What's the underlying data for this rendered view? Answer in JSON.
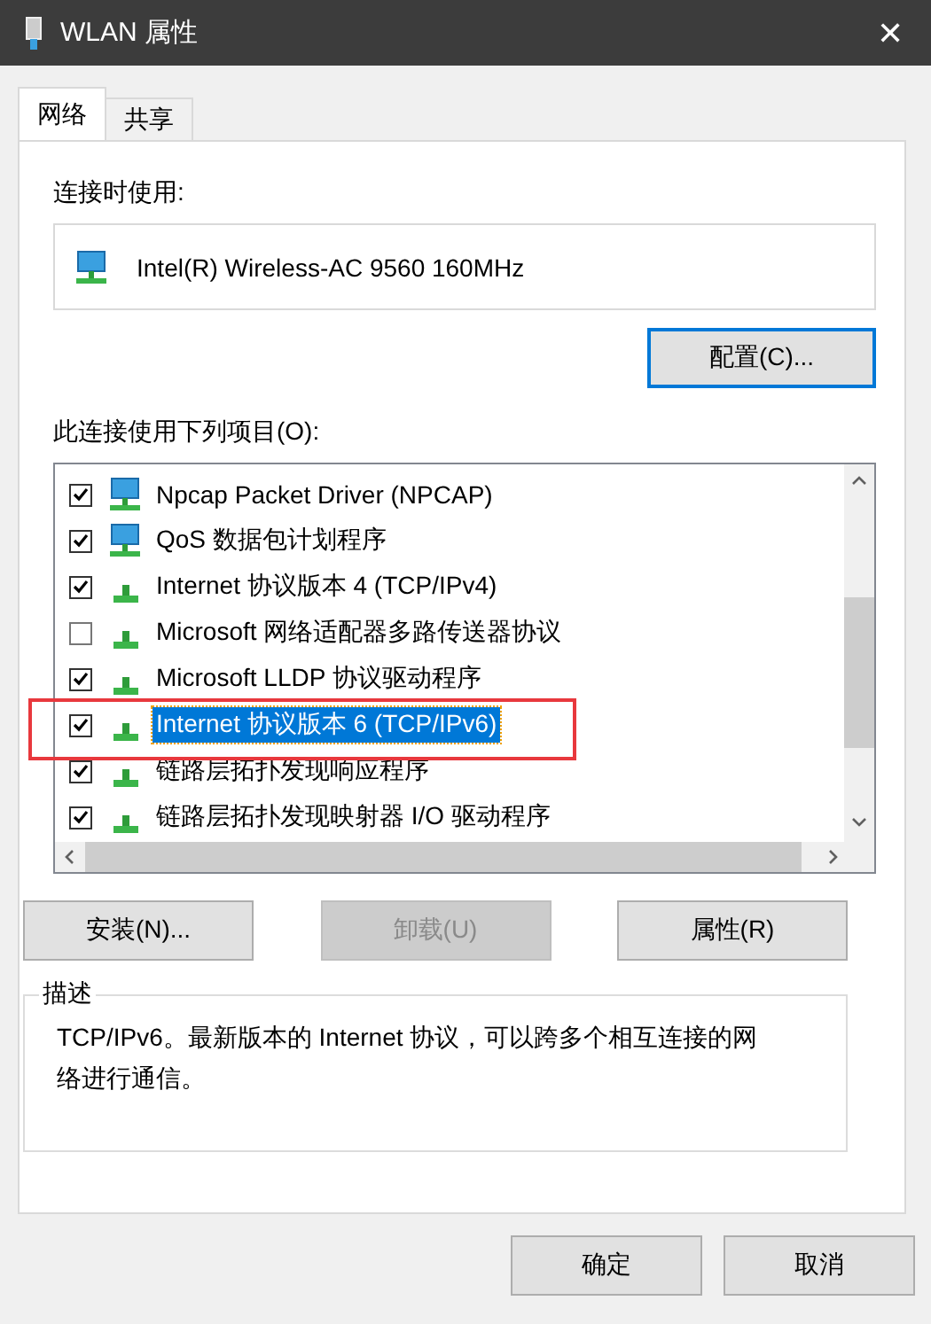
{
  "window": {
    "title": "WLAN 属性",
    "close": "✕"
  },
  "tabs": [
    {
      "label": "网络",
      "selected": true
    },
    {
      "label": "共享",
      "selected": false
    }
  ],
  "connect_using": {
    "label": "连接时使用:",
    "adapter": "Intel(R) Wireless-AC 9560 160MHz",
    "configure_button": "配置(C)..."
  },
  "items_label": "此连接使用下列项目(O):",
  "items": [
    {
      "kind": "service",
      "label": "Npcap Packet Driver (NPCAP)",
      "checked": true,
      "selected": false
    },
    {
      "kind": "service",
      "label": "QoS 数据包计划程序",
      "checked": true,
      "selected": false
    },
    {
      "kind": "protocol",
      "label": "Internet 协议版本 4 (TCP/IPv4)",
      "checked": true,
      "selected": false
    },
    {
      "kind": "protocol",
      "label": "Microsoft 网络适配器多路传送器协议",
      "checked": false,
      "selected": false
    },
    {
      "kind": "protocol",
      "label": "Microsoft LLDP 协议驱动程序",
      "checked": true,
      "selected": false
    },
    {
      "kind": "protocol",
      "label": "Internet 协议版本 6 (TCP/IPv6)",
      "checked": true,
      "selected": true
    },
    {
      "kind": "protocol",
      "label": "链路层拓扑发现响应程序",
      "checked": true,
      "selected": false
    },
    {
      "kind": "protocol",
      "label": "链路层拓扑发现映射器 I/O 驱动程序",
      "checked": true,
      "selected": false
    }
  ],
  "item_buttons": [
    {
      "label": "安装(N)...",
      "disabled": false
    },
    {
      "label": "卸载(U)",
      "disabled": true
    },
    {
      "label": "属性(R)",
      "disabled": false
    }
  ],
  "description": {
    "legend": "描述",
    "text": "TCP/IPv6。最新版本的 Internet 协议，可以跨多个相互连接的网络进行通信。"
  },
  "footer_buttons": [
    "确定",
    "取消"
  ]
}
